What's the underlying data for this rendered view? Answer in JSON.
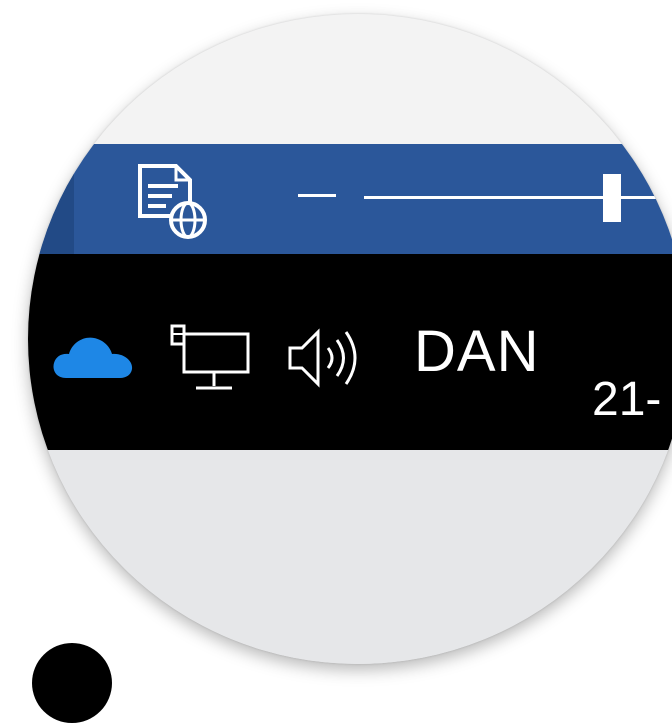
{
  "word_statusbar": {
    "icons": {
      "view_mode": "web-layout-icon"
    },
    "zoom": {
      "minus_icon": "minus-icon"
    },
    "colors": {
      "background": "#2b579a",
      "dark_segment": "#224a86",
      "foreground": "#ffffff"
    }
  },
  "taskbar": {
    "tray_icons": [
      "onedrive-icon",
      "network-icon",
      "volume-icon"
    ],
    "language": "DAN",
    "clock": "21-",
    "colors": {
      "background": "#000000",
      "onedrive": "#1e87e6",
      "text": "#ffffff"
    }
  }
}
